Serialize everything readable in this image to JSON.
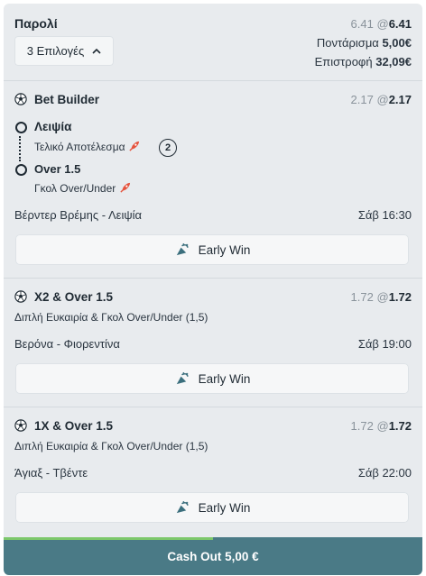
{
  "parlay": {
    "title": "Παρολί",
    "selections_label": "3 Επιλογές",
    "odds_prev": "6.41",
    "odds_at": "@",
    "odds_current": "6.41",
    "stake_label": "Ποντάρισμα",
    "stake_value": "5,00€",
    "return_label": "Επιστροφή",
    "return_value": "32,09€"
  },
  "bets": [
    {
      "title": "Bet Builder",
      "odds_prev": "2.17",
      "odds_current": "2.17",
      "legs": [
        {
          "name": "Λειψία",
          "market": "Τελικό Αποτέλεσμα"
        },
        {
          "name": "Over 1.5",
          "market": "Γκολ Over/Under"
        }
      ],
      "badge": "2",
      "match": "Βέρντερ Βρέμης - Λειψία",
      "time": "Σάβ 16:30",
      "early_win": "Early Win"
    },
    {
      "title": "X2 & Over 1.5",
      "odds_prev": "1.72",
      "odds_current": "1.72",
      "market": "Διπλή Ευκαιρία & Γκολ Over/Under (1,5)",
      "match": "Βερόνα - Φιορεντίνα",
      "time": "Σάβ 19:00",
      "early_win": "Early Win"
    },
    {
      "title": "1X & Over 1.5",
      "odds_prev": "1.72",
      "odds_current": "1.72",
      "market": "Διπλή Ευκαιρία & Γκολ Over/Under (1,5)",
      "match": "Άγιαξ - Τβέντε",
      "time": "Σάβ 22:00",
      "early_win": "Early Win"
    }
  ],
  "cashout": {
    "label": "Cash Out 5,00 €",
    "progress": 0.5
  },
  "colors": {
    "card_bg": "#e8ebee",
    "cashout_bg": "#4a7a86",
    "progress": "#7cc76b",
    "boost_icon": "#e5533d"
  },
  "icons": {
    "sport": "soccer-ball-icon",
    "early_win": "early-win-icon",
    "boost": "rocket-icon",
    "expand": "chevron-up-icon"
  }
}
